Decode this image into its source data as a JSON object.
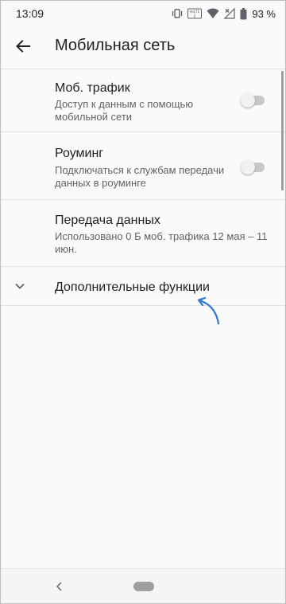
{
  "status_bar": {
    "time": "13:09",
    "volte_label": "VoLTE",
    "battery_text": "93 %",
    "icons": [
      "vibrate-icon",
      "volte-icon",
      "wifi-icon",
      "signal-no-service-icon",
      "battery-icon"
    ]
  },
  "app_bar": {
    "title": "Мобильная сеть",
    "back_icon": "arrow-back-icon"
  },
  "items": [
    {
      "title": "Моб. трафик",
      "summary": "Доступ к данным с помощью мобильной сети",
      "toggle": "off"
    },
    {
      "title": "Роуминг",
      "summary": "Подключаться к службам передачи данных в роуминге",
      "toggle": "off"
    },
    {
      "title": "Передача данных",
      "summary": "Использовано 0 Б моб. трафика 12 мая – 11 июн."
    }
  ],
  "advanced": {
    "label": "Дополнительные функции",
    "icon": "chevron-down-icon"
  },
  "colors": {
    "accent_arrow": "#2b7bd1",
    "switch_track": "#c8c8c8",
    "switch_thumb": "#f1f1f1"
  }
}
